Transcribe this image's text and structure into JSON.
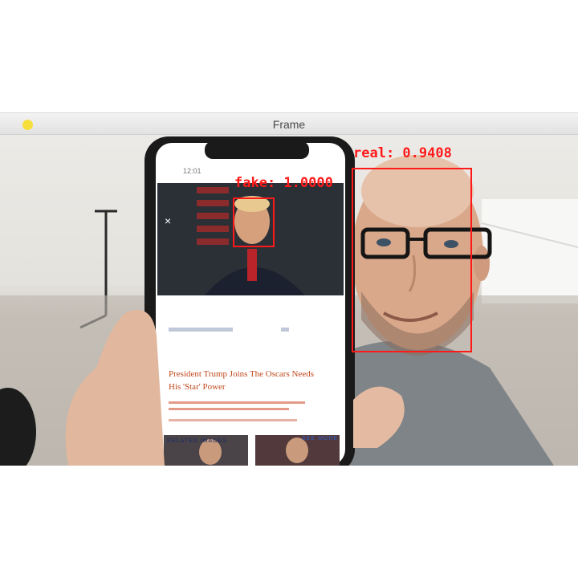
{
  "window": {
    "title": "Frame"
  },
  "detections": [
    {
      "label": "fake: 1.0000"
    },
    {
      "label": "real: 0.9408"
    }
  ],
  "phone": {
    "time": "12:01",
    "close": "×",
    "headline": "President Trump Joins The Oscars Needs His 'Star' Power",
    "related_label": "RELATED IMAGES",
    "see_more_label": "SEE MORE"
  },
  "colors": {
    "detection": "#ff1a1a",
    "traffic_light": "#f6df3b"
  }
}
